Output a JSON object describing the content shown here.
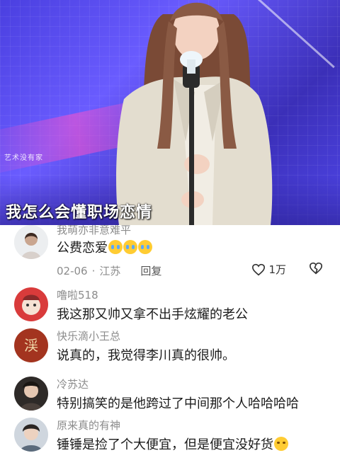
{
  "video": {
    "watermark": "艺术没有家",
    "subtitle": "我怎么会懂职场恋情"
  },
  "comments": [
    {
      "username": "我萌亦非意难平",
      "text": "公费恋爱",
      "emoji_count": 3,
      "date": "02-06",
      "location": "江苏",
      "reply_label": "回复",
      "likes": "1万"
    },
    {
      "username": "噜啦518",
      "text": "我这那又帅又拿不出手炫耀的老公"
    },
    {
      "username": "快乐滴小王总",
      "text": "说真的，我觉得李川真的很帅。"
    },
    {
      "username": "冷苏达",
      "text": "特别搞笑的是他跨过了中间那个人哈哈哈哈"
    },
    {
      "username": "原来真的有神",
      "text": "锤锤是捡了个大便宜，但是便宜没好货"
    }
  ],
  "colors": {
    "stage_blue": "#4a3fe0",
    "text_primary": "#1a1a1a",
    "text_secondary": "#8c8c8c"
  }
}
